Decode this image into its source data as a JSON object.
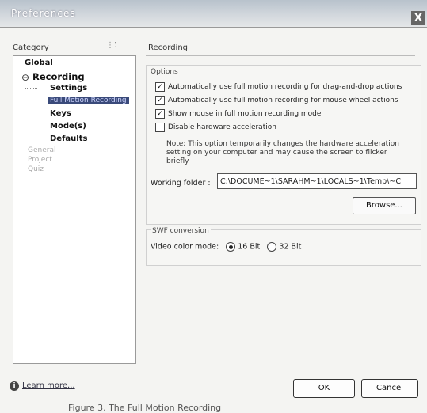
{
  "window": {
    "title": "Preferences",
    "close_glyph": "X"
  },
  "category": {
    "label": "Category",
    "items": [
      {
        "label": "Global"
      },
      {
        "label": "Recording"
      },
      {
        "label": "Settings"
      },
      {
        "label": "Full Motion Recording"
      },
      {
        "label": "Keys"
      },
      {
        "label": "Mode(s)"
      },
      {
        "label": "Defaults"
      },
      {
        "label": "General"
      },
      {
        "label": "Project"
      },
      {
        "label": "Quiz"
      }
    ]
  },
  "panel": {
    "title": "Recording",
    "options_legend": "Options",
    "options": [
      {
        "label": "Automatically use full motion recording for drag-and-drop actions",
        "checked": true
      },
      {
        "label": "Automatically use full motion recording for mouse wheel actions",
        "checked": true
      },
      {
        "label": "Show mouse in full motion recording mode",
        "checked": true
      },
      {
        "label": "Disable hardware acceleration",
        "checked": false
      }
    ],
    "note": "Note: This option temporarily changes the hardware acceleration setting on your computer and may cause the screen to flicker briefly.",
    "working_folder": {
      "label": "Working folder :",
      "value": "C:\\DOCUME~1\\SARAHM~1\\LOCALS~1\\Temp\\~C"
    },
    "browse_label": "Browse...",
    "swf": {
      "legend": "SWF conversion",
      "color_mode_label": "Video color mode:",
      "options": [
        {
          "label": "16 Bit",
          "selected": true
        },
        {
          "label": "32 Bit",
          "selected": false
        }
      ]
    }
  },
  "footer": {
    "learn_more": "Learn more...",
    "ok": "OK",
    "cancel": "Cancel",
    "caption": "Figure 3. The Full Motion Recording"
  }
}
